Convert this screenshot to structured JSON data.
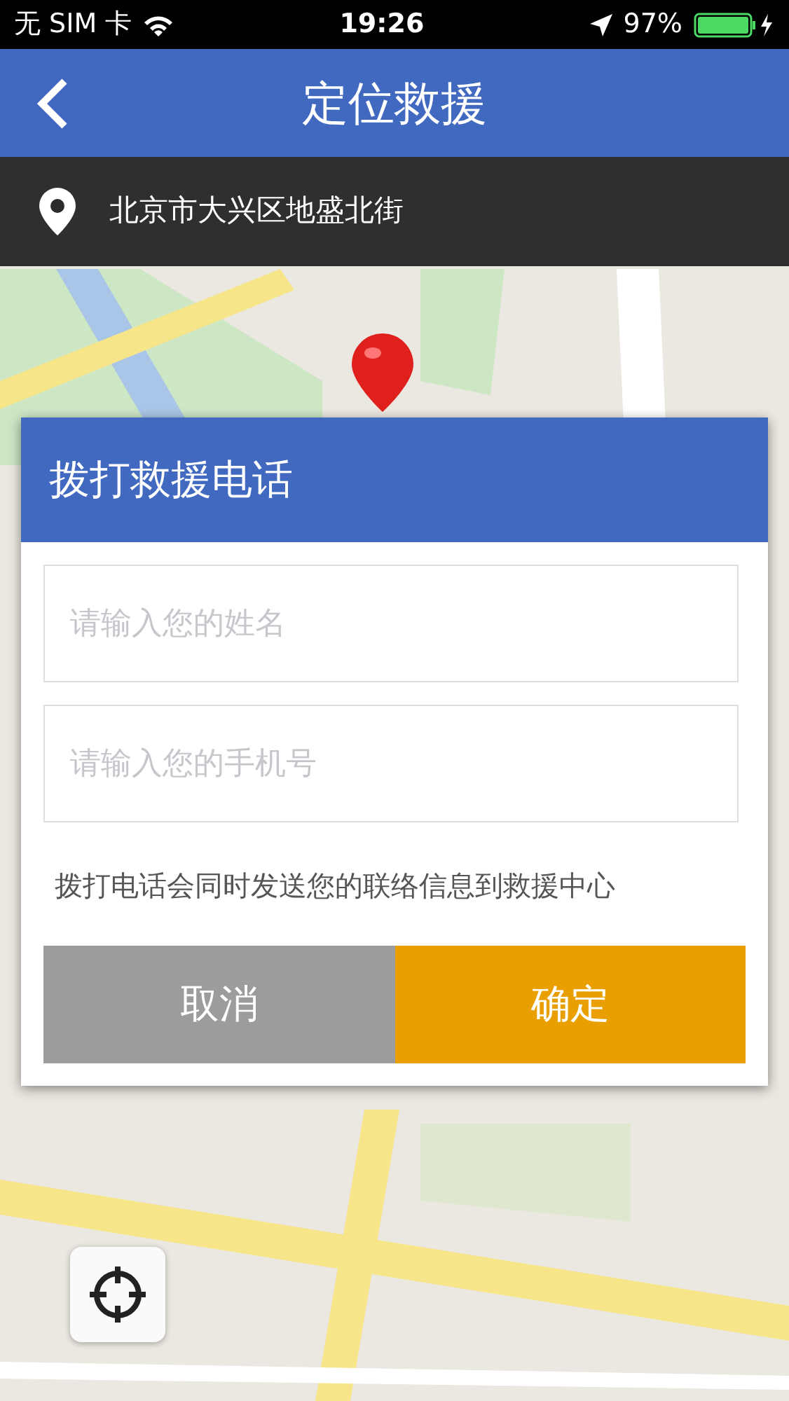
{
  "status_bar": {
    "carrier": "无 SIM 卡",
    "time": "19:26",
    "battery": "97%"
  },
  "nav_bar": {
    "title": "定位救援"
  },
  "location_bar": {
    "address": "北京市大兴区地盛北街"
  },
  "dialog": {
    "title": "拨打救援电话",
    "fields": [
      {
        "placeholder": "请输入您的姓名"
      },
      {
        "placeholder": "请输入您的手机号"
      }
    ],
    "note": "拨打电话会同时发送您的联络信息到救援中心",
    "buttons": [
      {
        "label": "取消",
        "kind": "cancel"
      },
      {
        "label": "确定",
        "kind": "confirm"
      }
    ]
  }
}
